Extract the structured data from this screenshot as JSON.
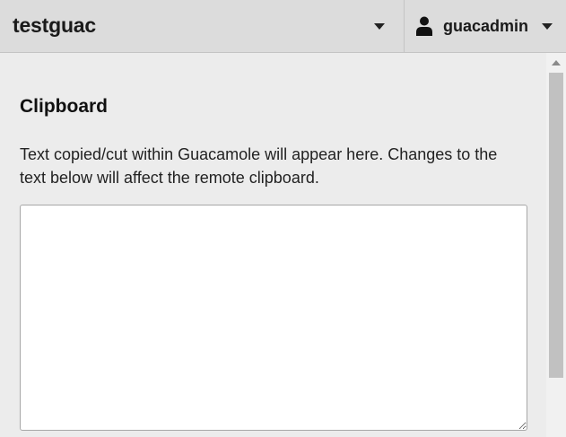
{
  "header": {
    "connection_title": "testguac",
    "username": "guacadmin"
  },
  "icons": {
    "connection_menu": "chevron-down-icon",
    "user": "user-icon",
    "user_menu": "chevron-down-icon"
  },
  "clipboard": {
    "title": "Clipboard",
    "description": "Text copied/cut within Guacamole will appear here. Changes to the text below will affect the remote clipboard.",
    "value": ""
  },
  "colors": {
    "header_bg": "#dcdcdc",
    "page_bg": "#ececec",
    "textarea_bg": "#ffffff"
  }
}
